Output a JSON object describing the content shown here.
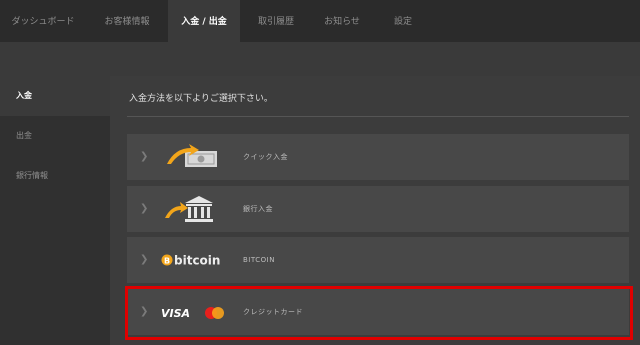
{
  "nav": {
    "tabs": [
      {
        "label": "ダッシュボード"
      },
      {
        "label": "お客様情報"
      },
      {
        "label": "入金 / 出金"
      },
      {
        "label": "取引履歴"
      },
      {
        "label": "お知らせ"
      },
      {
        "label": "設定"
      }
    ],
    "active_tab": "入金 / 出金"
  },
  "sidebar": {
    "items": [
      {
        "label": "入金"
      },
      {
        "label": "出金"
      },
      {
        "label": "銀行情報"
      }
    ],
    "active_item": "入金"
  },
  "main": {
    "heading": "入金方法を以下よりご選択下さい。",
    "methods": [
      {
        "label": "クイック入金",
        "icon": "quick-deposit-cash-icon"
      },
      {
        "label": "銀行入金",
        "icon": "bank-icon"
      },
      {
        "label": "BITCOIN",
        "icon": "bitcoin-logo",
        "logo_text": "bitcoin"
      },
      {
        "label": "クレジットカード",
        "icon": "visa-mastercard-logo",
        "logo_text": "VISA"
      }
    ],
    "selected_method": "クレジットカード"
  },
  "colors": {
    "highlight": "#e00000",
    "accent_gold": "#f2a51a"
  }
}
